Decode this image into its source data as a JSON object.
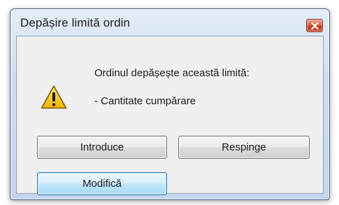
{
  "window": {
    "title": "Depășire limită ordin"
  },
  "message": {
    "line1": "Ordinul depășește această limită:",
    "line2": "- Cantitate cumpărare"
  },
  "icons": {
    "message_icon": "warning-triangle-icon",
    "close_icon": "close-icon"
  },
  "buttons": {
    "introduce": "Introduce",
    "respinge": "Respinge",
    "modifica": "Modifică"
  },
  "focused_button": "modifica"
}
